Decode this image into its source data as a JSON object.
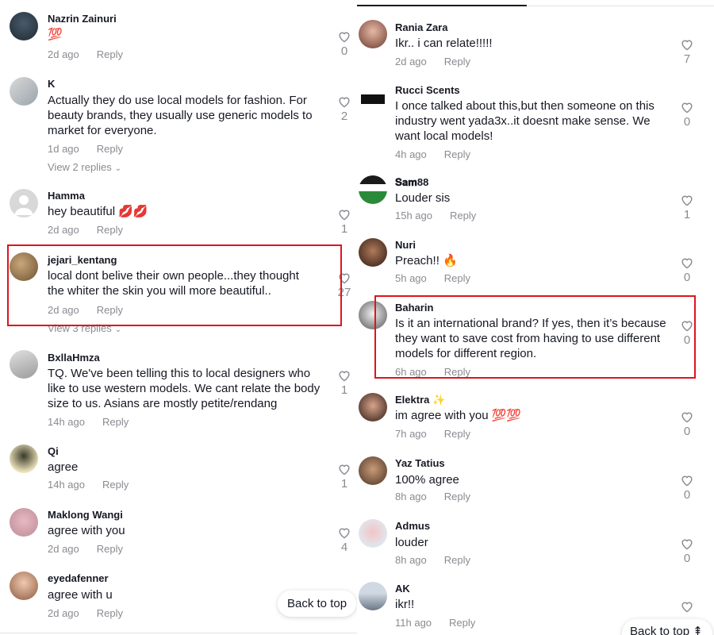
{
  "left": {
    "comments": [
      {
        "username": "Nazrin Zainuri",
        "text": "💯",
        "time": "2d ago",
        "reply": "Reply",
        "likes": "0"
      },
      {
        "username": "K",
        "text": "Actually they do use local models for fashion. For beauty brands, they usually use generic models to market for everyone.",
        "time": "1d ago",
        "reply": "Reply",
        "likes": "2",
        "view_replies": "View 2 replies"
      },
      {
        "username": "Hamma",
        "text": "hey beautiful 💋💋",
        "time": "2d ago",
        "reply": "Reply",
        "likes": "1"
      },
      {
        "username": "jejari_kentang",
        "text": "local dont belive their own people...they thought the whiter the skin you will more beautiful..",
        "time": "2d ago",
        "reply": "Reply",
        "likes": "27",
        "view_replies": "View 3 replies"
      },
      {
        "username": "BxllaHmza",
        "text": "TQ. We've been telling this to local designers who like to use western models. We cant relate the body size to us. Asians are mostly petite/rendang",
        "time": "14h ago",
        "reply": "Reply",
        "likes": "1"
      },
      {
        "username": "Qi",
        "text": "agree",
        "time": "14h ago",
        "reply": "Reply",
        "likes": "1"
      },
      {
        "username": "Maklong Wangi",
        "text": "agree with you",
        "time": "2d ago",
        "reply": "Reply",
        "likes": "4"
      },
      {
        "username": "eyedafenner",
        "text": "agree with u",
        "time": "2d ago",
        "reply": "Reply",
        "likes": ""
      }
    ],
    "back_to_top": "Back to top"
  },
  "right": {
    "comments": [
      {
        "username": "Rania Zara",
        "text": "Ikr.. i can relate!!!!!",
        "time": "2d ago",
        "reply": "Reply",
        "likes": "7"
      },
      {
        "username": "Rucci Scents",
        "text": "I once talked about this,but then someone on this industry went yada3x..it doesnt make sense. We want local models!",
        "time": "4h ago",
        "reply": "Reply",
        "likes": "0"
      },
      {
        "username": "𝐒𝐚𝐦88",
        "text": "Louder sis",
        "time": "15h ago",
        "reply": "Reply",
        "likes": "1"
      },
      {
        "username": "Nuri",
        "text": "Preach!! 🔥",
        "time": "5h ago",
        "reply": "Reply",
        "likes": "0"
      },
      {
        "username": "Baharin",
        "text": "Is it an international brand? If yes, then it’s because they want to save cost from having to use different models for different region.",
        "time": "6h ago",
        "reply": "Reply",
        "likes": "0"
      },
      {
        "username": "Elektra ✨",
        "text": "im agree with you 💯💯",
        "time": "7h ago",
        "reply": "Reply",
        "likes": "0"
      },
      {
        "username": "Yaz Tatius",
        "text": "100% agree",
        "time": "8h ago",
        "reply": "Reply",
        "likes": "0"
      },
      {
        "username": "Admus",
        "text": "louder",
        "time": "8h ago",
        "reply": "Reply",
        "likes": "0"
      },
      {
        "username": "AK",
        "text": "ikr!!",
        "time": "11h ago",
        "reply": "Reply",
        "likes": ""
      }
    ],
    "back_to_top": "Back to top ⇞"
  },
  "colors": {
    "highlight": "#e0141e",
    "text": "#161823",
    "muted": "#8a8b91"
  },
  "icons": {
    "like": "heart-outline-icon",
    "chevron": "chevron-down-icon"
  }
}
